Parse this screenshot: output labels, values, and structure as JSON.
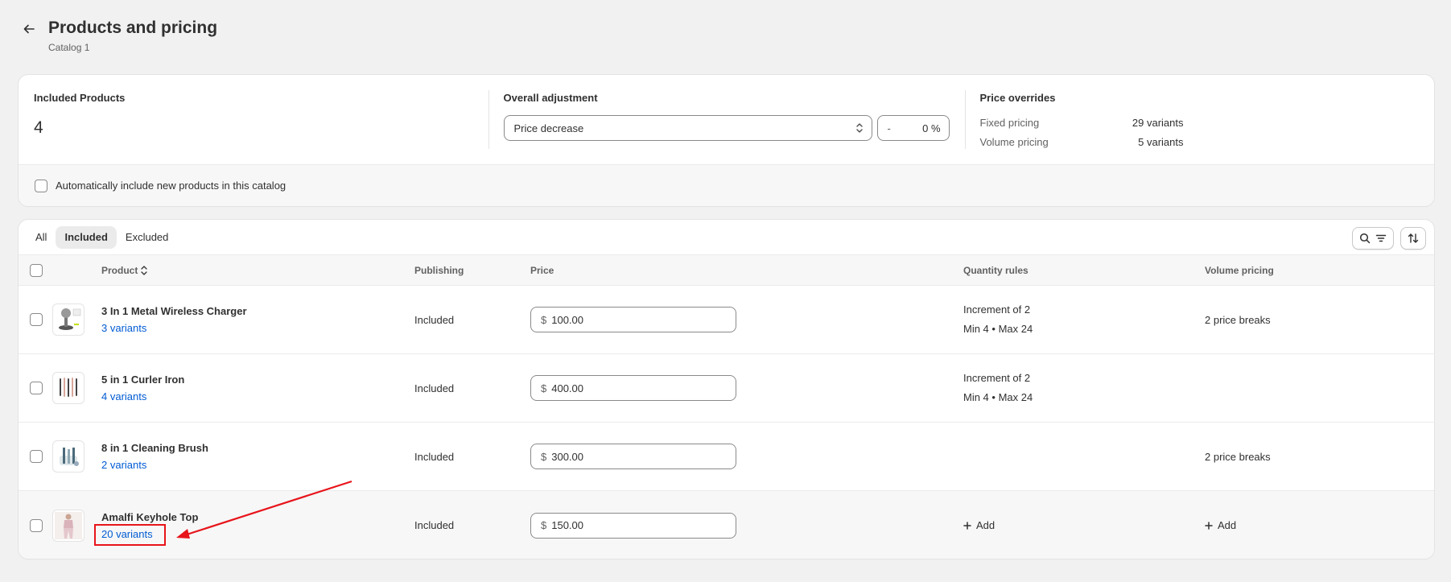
{
  "header": {
    "title": "Products and pricing",
    "subtitle": "Catalog 1"
  },
  "summary": {
    "included_label": "Included Products",
    "included_count": "4",
    "adjustment_label": "Overall adjustment",
    "adjustment_select": "Price decrease",
    "adjustment_sign": "-",
    "adjustment_value": "0",
    "adjustment_unit": "%",
    "overrides_label": "Price overrides",
    "overrides": [
      {
        "label": "Fixed pricing",
        "value": "29 variants"
      },
      {
        "label": "Volume pricing",
        "value": "5 variants"
      }
    ],
    "auto_include_label": "Automatically include new products in this catalog"
  },
  "tabs": [
    "All",
    "Included",
    "Excluded"
  ],
  "active_tab": "Included",
  "columns": {
    "product": "Product",
    "publishing": "Publishing",
    "price": "Price",
    "quantity_rules": "Quantity rules",
    "volume_pricing": "Volume pricing"
  },
  "rows": [
    {
      "name": "3 In 1 Metal Wireless Charger",
      "variants": "3 variants",
      "publishing": "Included",
      "currency": "$",
      "price": "100.00",
      "qty_line1": "Increment of 2",
      "qty_line2": "Min 4 • Max 24",
      "volume": "2 price breaks"
    },
    {
      "name": "5 in 1 Curler Iron",
      "variants": "4 variants",
      "publishing": "Included",
      "currency": "$",
      "price": "400.00",
      "qty_line1": "Increment of 2",
      "qty_line2": "Min 4 • Max 24",
      "volume": ""
    },
    {
      "name": "8 in 1 Cleaning Brush",
      "variants": "2 variants",
      "publishing": "Included",
      "currency": "$",
      "price": "300.00",
      "qty_line1": "",
      "qty_line2": "",
      "volume": "2 price breaks"
    },
    {
      "name": "Amalfi Keyhole Top",
      "variants": "20 variants",
      "publishing": "Included",
      "currency": "$",
      "price": "150.00",
      "qty_add": "Add",
      "volume_add": "Add"
    }
  ],
  "colors": {
    "link": "#005bd3",
    "annotation": "#e8141b"
  }
}
